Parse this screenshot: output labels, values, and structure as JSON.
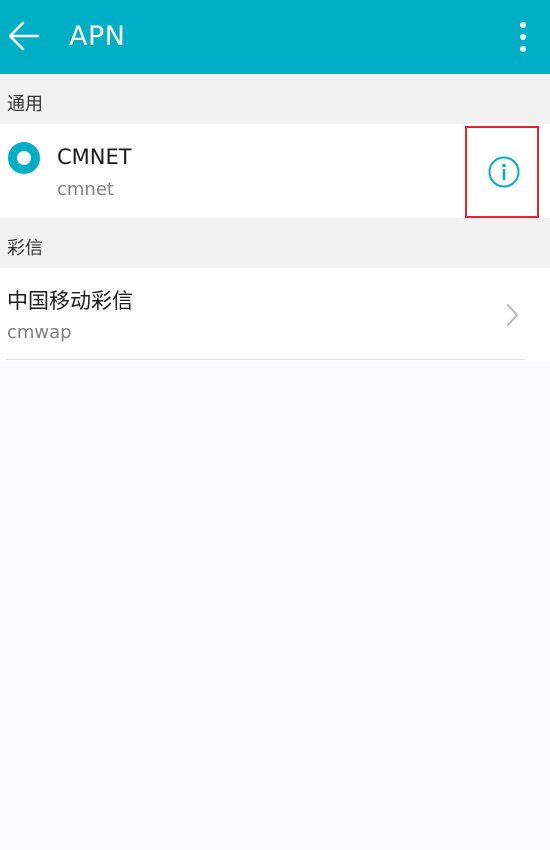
{
  "appbar": {
    "title": "APN",
    "back_icon": "arrow-left-icon",
    "menu_icon": "more-vertical-icon"
  },
  "sections": [
    {
      "label": "通用",
      "items": [
        {
          "name": "CMNET",
          "apn": "cmnet",
          "selected": true,
          "action_icon": "info-icon"
        }
      ]
    },
    {
      "label": "彩信",
      "items": [
        {
          "name": "中国移动彩信",
          "apn": "cmwap",
          "action_icon": "chevron-right-icon"
        }
      ]
    }
  ],
  "colors": {
    "accent": "#00aec6",
    "highlight_box": "#e0262e"
  }
}
